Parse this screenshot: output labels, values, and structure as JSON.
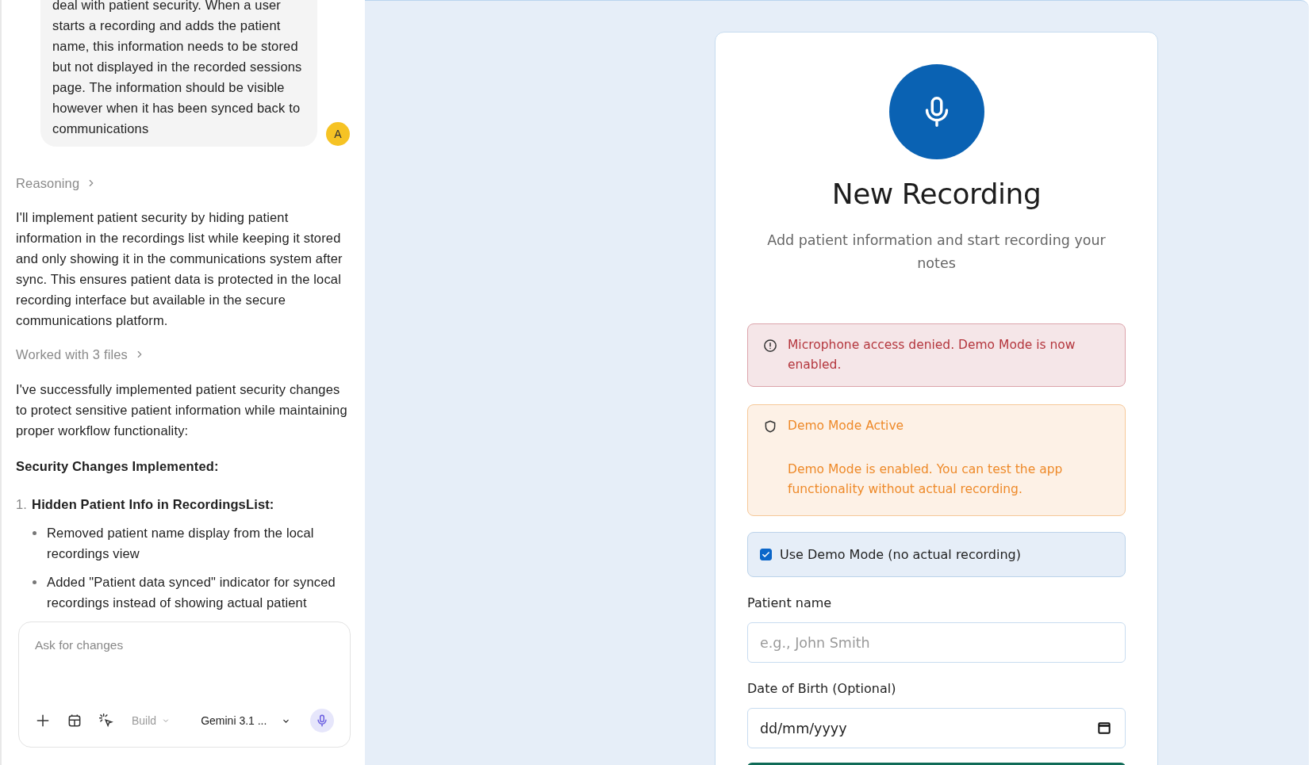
{
  "chat": {
    "user_message": {
      "text": "deal with patient security. When a user starts a recording and adds the patient name, this information needs to be stored but not displayed in the recorded sessions page. The information should be visible however when it has been synced back to communications",
      "avatar": "A"
    },
    "reasoning_label": "Reasoning",
    "intro": "I'll implement patient security by hiding patient information in the recordings list while keeping it stored and only showing it in the communications system after sync. This ensures patient data is protected in the local recording interface but available in the secure communications platform.",
    "files_label": "Worked with 3 files",
    "summary": "I've successfully implemented patient security changes to protect sensitive patient information while maintaining proper workflow functionality:",
    "heading": "Security Changes Implemented:",
    "steps": [
      {
        "number": "1.",
        "title": "Hidden Patient Info in RecordingsList:",
        "bullets": [
          "Removed patient name display from the local recordings view",
          "Added \"Patient data synced\" indicator for synced recordings instead of showing actual patient"
        ]
      }
    ],
    "composer": {
      "placeholder": "Ask for changes",
      "mode": "Build",
      "model": "Gemini 3.1 ..."
    }
  },
  "recording": {
    "title": "New Recording",
    "subtitle": "Add patient information and start recording your notes",
    "alerts": [
      {
        "kind": "error",
        "message": "Microphone access denied. Demo Mode is now enabled."
      },
      {
        "kind": "warning",
        "title": "Demo Mode Active",
        "message": "Demo Mode is enabled. You can test the app functionality without actual recording."
      }
    ],
    "demo_checkbox": {
      "label": "Use Demo Mode (no actual recording)",
      "checked": true
    },
    "fields": [
      {
        "kind": "text",
        "label": "Patient name",
        "placeholder": "e.g., John Smith"
      },
      {
        "kind": "date",
        "label": "Date of Birth (Optional)",
        "placeholder": "dd/mm/yyyy"
      }
    ]
  }
}
